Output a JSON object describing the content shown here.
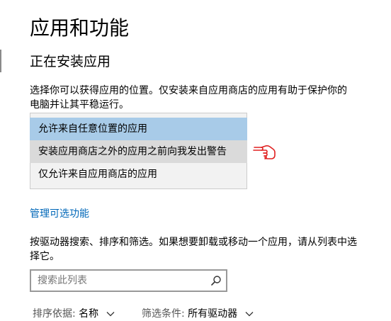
{
  "page": {
    "title": "应用和功能"
  },
  "install_section": {
    "title": "正在安装应用",
    "description": "选择你可以获得应用的位置。仅安装来自应用商店的应用有助于保护你的电脑并让其平稳运行。",
    "options": [
      {
        "label": "允许来自任意位置的应用",
        "state": "highlighted"
      },
      {
        "label": "安装应用商店之外的应用之前向我发出警告",
        "state": "hover"
      },
      {
        "label": "仅允许来自应用商店的应用",
        "state": "normal"
      }
    ]
  },
  "manage_link": {
    "label": "管理可选功能"
  },
  "list_section": {
    "description": "按驱动器搜索、排序和筛选。如果想要卸载或移动一个应用，请从列表中选择它。",
    "search": {
      "placeholder": "搜索此列表",
      "value": ""
    },
    "sort": {
      "label": "排序依据:",
      "value": "名称"
    },
    "filter": {
      "label": "筛选条件:",
      "value": "所有驱动器"
    }
  },
  "icons": {
    "hand_pointer": "hand-pointer-icon",
    "search": "search-icon",
    "chevron": "chevron-down-icon"
  },
  "colors": {
    "selected_option_bg": "#a8cbe8",
    "hover_option_bg": "#dadada",
    "dropdown_bg": "#f2f2f2",
    "link": "#0067b8",
    "hand_annotation": "#e02020"
  }
}
